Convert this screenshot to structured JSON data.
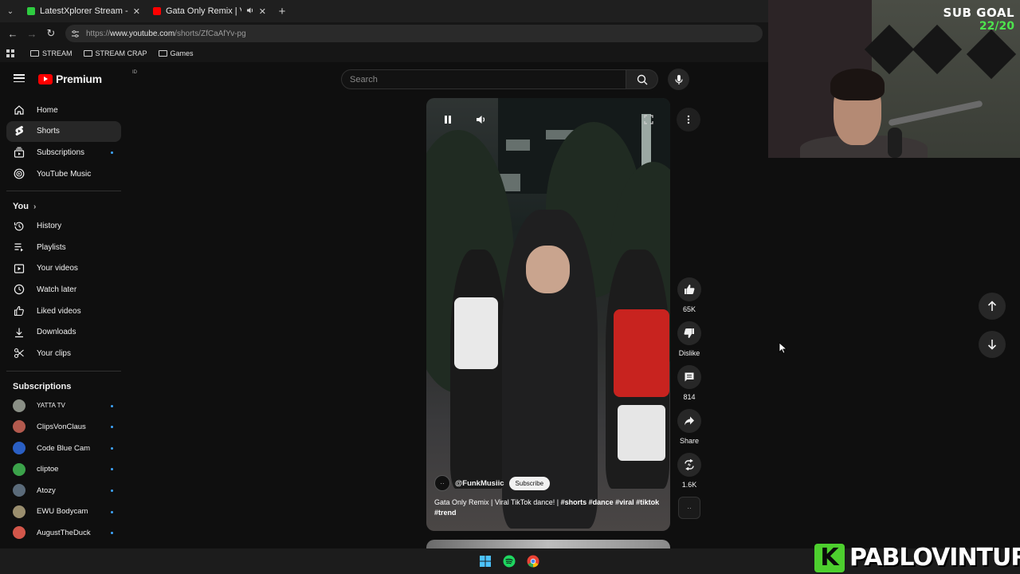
{
  "browser": {
    "tabs": [
      {
        "title": "LatestXplorer Stream - Watch Li",
        "favicon_color": "#2ecc40",
        "has_audio": false
      },
      {
        "title": "Gata Only Remix | Viral TikTo",
        "favicon_color": "#ff0000",
        "has_audio": true
      }
    ],
    "url_prefix": "https://",
    "url_host": "www.youtube.com",
    "url_path": "/shorts/ZfCaAfYv-pg",
    "bookmarks": [
      "STREAM",
      "STREAM CRAP",
      "Games"
    ]
  },
  "youtube": {
    "logo_text": "Premium",
    "logo_region": "ID",
    "search_placeholder": "Search",
    "sidebar": {
      "main": [
        {
          "label": "Home",
          "icon": "home-icon",
          "active": false,
          "dot": false
        },
        {
          "label": "Shorts",
          "icon": "shorts-icon",
          "active": true,
          "dot": false
        },
        {
          "label": "Subscriptions",
          "icon": "subscriptions-icon",
          "active": false,
          "dot": true
        },
        {
          "label": "YouTube Music",
          "icon": "youtube-music-icon",
          "active": false,
          "dot": false
        }
      ],
      "you_heading": "You",
      "you": [
        {
          "label": "History",
          "icon": "history-icon"
        },
        {
          "label": "Playlists",
          "icon": "playlists-icon"
        },
        {
          "label": "Your videos",
          "icon": "your-videos-icon"
        },
        {
          "label": "Watch later",
          "icon": "watch-later-icon"
        },
        {
          "label": "Liked videos",
          "icon": "liked-videos-icon"
        },
        {
          "label": "Downloads",
          "icon": "downloads-icon"
        },
        {
          "label": "Your clips",
          "icon": "clips-icon"
        }
      ],
      "subscriptions_heading": "Subscriptions",
      "subscriptions": [
        {
          "label": "YATTA TV",
          "color": "#8a8f86"
        },
        {
          "label": "ClipsVonClaus",
          "color": "#b35a4e"
        },
        {
          "label": "Code Blue Cam",
          "color": "#2a5fc4"
        },
        {
          "label": "cliptoe",
          "color": "#3ba24a"
        },
        {
          "label": "Atozy",
          "color": "#5b6b7a"
        },
        {
          "label": "EWU Bodycam",
          "color": "#9a8e6e"
        },
        {
          "label": "AugustTheDuck",
          "color": "#d2564a"
        }
      ]
    },
    "short": {
      "channel": "@FunkMusiic",
      "subscribe_label": "Subscribe",
      "title_plain": "Gata Only Remix | Viral TikTok dance! | ",
      "hashtags_line1": "#shorts #dance #viral #tiktok",
      "hashtags_line2": "#trend",
      "likes": "65K",
      "dislike_label": "Dislike",
      "comments": "814",
      "share_label": "Share",
      "remix_count": "1.6K"
    }
  },
  "overlay": {
    "sub_goal_label": "SUB GOAL",
    "sub_goal_value": "22/20",
    "brand_letter": "K",
    "brand_name": "PABLOVINTURA"
  },
  "colors": {
    "accent_red": "#ff0000",
    "link_blue": "#3ea6ff",
    "goal_green": "#4de44d",
    "brand_green": "#4dcf2e"
  }
}
